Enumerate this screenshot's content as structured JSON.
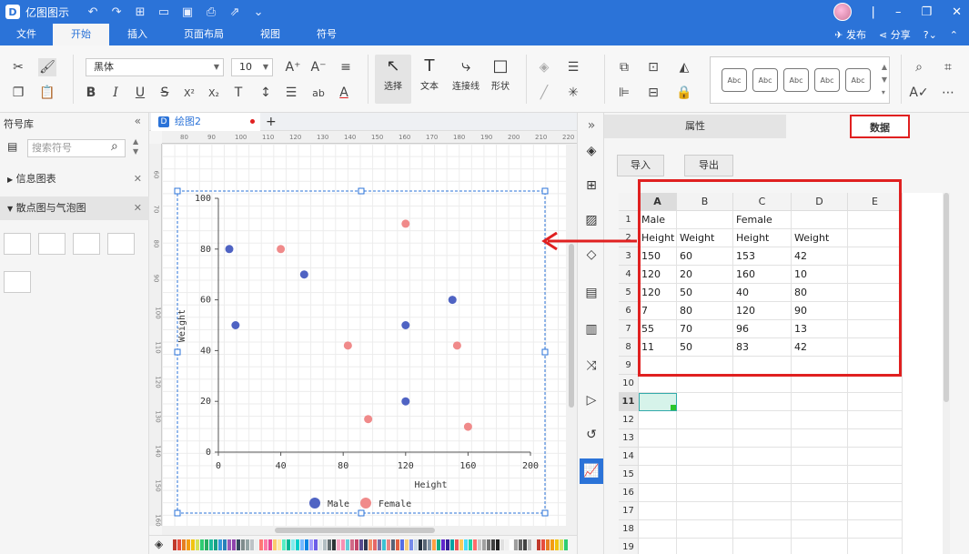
{
  "app": {
    "title": "亿图图示",
    "logo_letter": "D",
    "publish_label": "发布",
    "share_label": "分享",
    "help_label": "?"
  },
  "menu": {
    "tabs": [
      "文件",
      "开始",
      "插入",
      "页面布局",
      "视图",
      "符号"
    ],
    "active_index": 1
  },
  "ribbon": {
    "font_name": "黑体",
    "font_size": "10",
    "select_label": "选择",
    "text_label": "文本",
    "connector_label": "连接线",
    "shape_label": "形状",
    "style_preset_label": "Abc"
  },
  "library": {
    "title": "符号库",
    "search_placeholder": "搜索符号",
    "categories": [
      {
        "label": "信息图表",
        "expanded": false
      },
      {
        "label": "散点图与气泡图",
        "expanded": true
      }
    ]
  },
  "document": {
    "tab_label": "绘图2",
    "add_tab": "+"
  },
  "rulers": {
    "top": [
      "80",
      "90",
      "100",
      "110",
      "120",
      "130",
      "140",
      "150",
      "160",
      "170",
      "180",
      "190",
      "200",
      "210",
      "220"
    ],
    "left": [
      "60",
      "70",
      "80",
      "90",
      "100",
      "110",
      "120",
      "130",
      "140",
      "150",
      "160"
    ]
  },
  "chart_data": {
    "type": "scatter",
    "xlabel": "Height",
    "ylabel": "Weight",
    "xlim": [
      0,
      200
    ],
    "ylim": [
      0,
      100
    ],
    "xticks": [
      "0",
      "40",
      "80",
      "120",
      "160",
      "200"
    ],
    "yticks": [
      "0",
      "20",
      "40",
      "60",
      "80",
      "100"
    ],
    "grid": false,
    "legend": "bottom",
    "series": [
      {
        "name": "Male",
        "color": "#4f63c3",
        "x": [
          150,
          120,
          120,
          7,
          55,
          11
        ],
        "y": [
          60,
          20,
          50,
          80,
          70,
          50
        ]
      },
      {
        "name": "Female",
        "color": "#f08a8a",
        "x": [
          153,
          160,
          40,
          120,
          96,
          83
        ],
        "y": [
          42,
          10,
          80,
          90,
          13,
          42
        ]
      }
    ]
  },
  "panel": {
    "properties_tab": "属性",
    "data_tab": "数据",
    "import_label": "导入",
    "export_label": "导出"
  },
  "sheet": {
    "columns": [
      "A",
      "B",
      "C",
      "D",
      "E"
    ],
    "row_numbers": [
      "1",
      "2",
      "3",
      "4",
      "5",
      "6",
      "7",
      "8",
      "9",
      "10",
      "11",
      "12",
      "13",
      "14",
      "15",
      "16",
      "17",
      "18",
      "19"
    ],
    "rows": [
      [
        "Male",
        "",
        "Female",
        ""
      ],
      [
        "Height",
        "Weight",
        "Height",
        "Weight"
      ],
      [
        "150",
        "60",
        "153",
        "42"
      ],
      [
        "120",
        "20",
        "160",
        "10"
      ],
      [
        "120",
        "50",
        "40",
        "80"
      ],
      [
        "7",
        "80",
        "120",
        "90"
      ],
      [
        "55",
        "70",
        "96",
        "13"
      ],
      [
        "11",
        "50",
        "83",
        "42"
      ]
    ],
    "selected_row": "11",
    "selected_col": "A"
  },
  "colors": {
    "accent": "#2b73d8",
    "highlight_red": "#e02020",
    "male": "#4f63c3",
    "female": "#f08a8a"
  }
}
